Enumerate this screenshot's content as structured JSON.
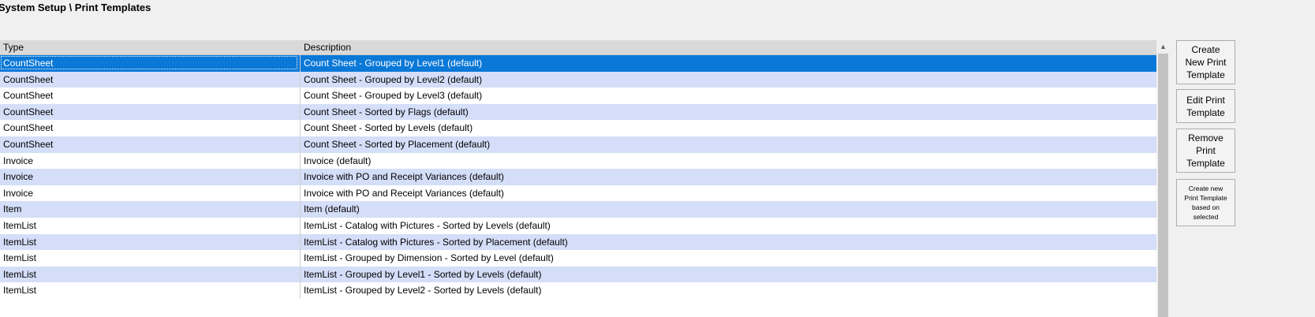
{
  "header": {
    "title": "System Setup \\ Print Templates"
  },
  "grid": {
    "columns": {
      "type": "Type",
      "description": "Description"
    },
    "rows": [
      {
        "type": "CountSheet",
        "description": "Count Sheet - Grouped by Level1 (default)",
        "selected": true
      },
      {
        "type": "CountSheet",
        "description": "Count Sheet - Grouped by Level2 (default)"
      },
      {
        "type": "CountSheet",
        "description": "Count Sheet - Grouped by Level3 (default)"
      },
      {
        "type": "CountSheet",
        "description": "Count Sheet - Sorted by Flags (default)"
      },
      {
        "type": "CountSheet",
        "description": "Count Sheet - Sorted by Levels (default)"
      },
      {
        "type": "CountSheet",
        "description": "Count Sheet - Sorted by Placement (default)"
      },
      {
        "type": "Invoice",
        "description": "Invoice (default)"
      },
      {
        "type": "Invoice",
        "description": "Invoice with PO and Receipt Variances (default)"
      },
      {
        "type": "Invoice",
        "description": "Invoice with PO and Receipt Variances (default)"
      },
      {
        "type": "Item",
        "description": "Item (default)"
      },
      {
        "type": "ItemList",
        "description": "ItemList - Catalog with Pictures - Sorted by Levels (default)"
      },
      {
        "type": "ItemList",
        "description": "ItemList - Catalog with Pictures - Sorted by Placement (default)"
      },
      {
        "type": "ItemList",
        "description": "ItemList - Grouped by Dimension - Sorted by Level (default)"
      },
      {
        "type": "ItemList",
        "description": "ItemList - Grouped by Level1 -  Sorted by Levels (default)"
      },
      {
        "type": "ItemList",
        "description": "ItemList - Grouped by Level2 - Sorted by Levels (default)"
      }
    ]
  },
  "scrollbar": {
    "up_icon": "chevron-up-icon"
  },
  "buttons": {
    "create": "Create\nNew Print\nTemplate",
    "edit": "Edit Print\nTemplate",
    "remove": "Remove\nPrint\nTemplate",
    "create_based": "Create new\nPrint Template\nbased on\nselected"
  },
  "colors": {
    "selected_row": "#0a78d7",
    "alt_row": "#d4def8",
    "header_bg": "#d9d9d9"
  }
}
